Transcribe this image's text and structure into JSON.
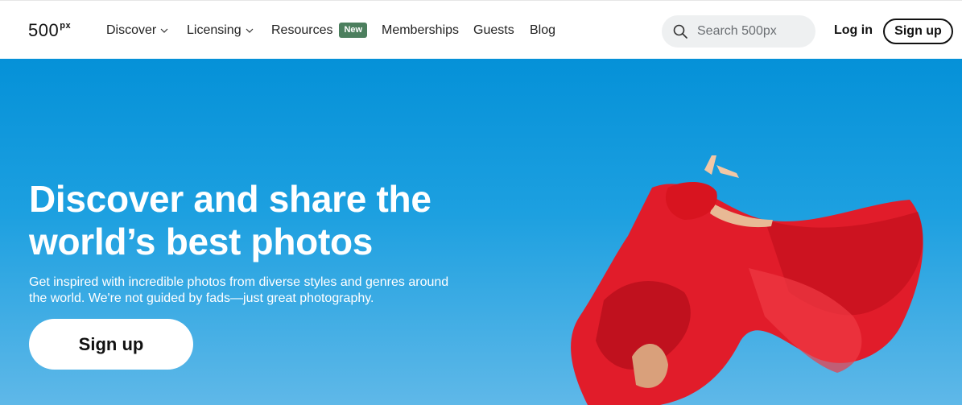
{
  "header": {
    "logo_main": "500",
    "logo_sup": "px",
    "nav": [
      {
        "label": "Discover",
        "has_dropdown": true
      },
      {
        "label": "Licensing",
        "has_dropdown": true
      },
      {
        "label": "Resources",
        "badge": "New"
      },
      {
        "label": "Memberships"
      },
      {
        "label": "Guests"
      },
      {
        "label": "Blog"
      }
    ],
    "search": {
      "placeholder": "Search 500px",
      "icon": "search-icon"
    },
    "login_label": "Log in",
    "signup_label": "Sign up"
  },
  "hero": {
    "title_line1": "Discover and share the",
    "title_line2": "world’s best photos",
    "subtitle": "Get inspired with incredible photos from diverse styles and genres around the world. We're not guided by fads—just great photography.",
    "cta_label": "Sign up",
    "image": "dancer-in-red-fabric-against-blue-sky"
  },
  "colors": {
    "hero_sky_top": "#0591d8",
    "hero_sky_bottom": "#5fb8e8",
    "badge_green": "#4c7f5e",
    "fabric_red": "#e0202a"
  }
}
